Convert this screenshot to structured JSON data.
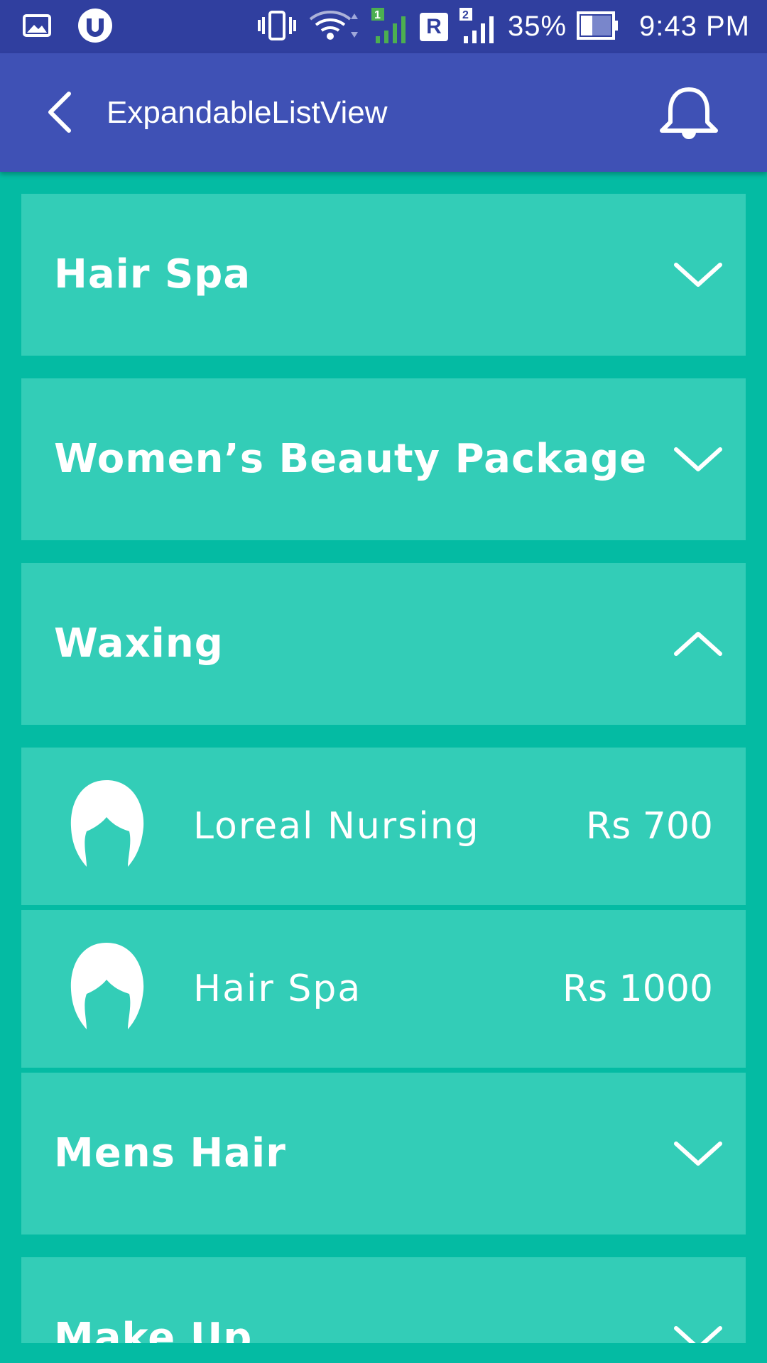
{
  "status_bar": {
    "battery": "35%",
    "time": "9:43 PM",
    "sim1": "1",
    "sim2": "2",
    "roaming": "R"
  },
  "app_bar": {
    "title": "ExpandableListView"
  },
  "groups": [
    {
      "title": "Hair Spa",
      "expanded": false
    },
    {
      "title": "Women’s Beauty Package",
      "expanded": false
    },
    {
      "title": "Waxing",
      "expanded": true
    },
    {
      "title": "Mens Hair",
      "expanded": false
    },
    {
      "title": "Make Up",
      "expanded": false
    }
  ],
  "waxing_items": [
    {
      "name": "Loreal Nursing",
      "price": "Rs 700",
      "icon": "hair-icon"
    },
    {
      "name": "Hair Spa",
      "price": "Rs 1000",
      "icon": "hair-icon"
    }
  ],
  "colors": {
    "status_bar": "#303f9f",
    "app_bar": "#3f51b5",
    "background": "#04bba3",
    "card": "#33cdb7",
    "text": "#ffffff"
  }
}
